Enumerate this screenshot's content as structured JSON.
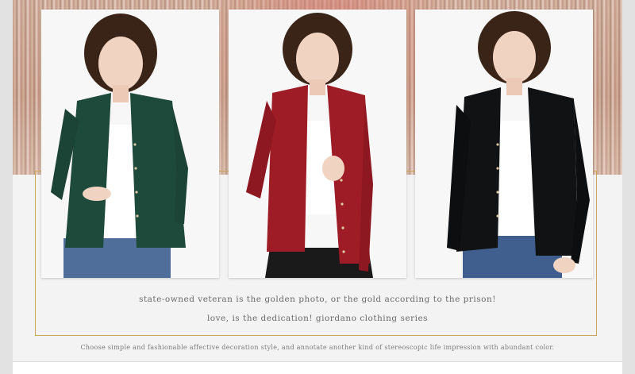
{
  "captions": {
    "line1": "state-owned veteran is the golden photo, or the gold according to the prison!",
    "line2": "love, is the dedication! giordano clothing series",
    "line3": "Choose simple and fashionable affective decoration style, and annotate another kind of stereoscopic life impression with abundant color."
  },
  "photos": [
    {
      "subject": "model-green-cardigan",
      "cardigan_color": "#1e4a3c"
    },
    {
      "subject": "model-red-cardigan",
      "cardigan_color": "#9e1c26"
    },
    {
      "subject": "model-black-cardigan",
      "cardigan_color": "#111214"
    }
  ],
  "colors": {
    "frame_gold": "#c9a65a",
    "caption_text": "#6a6a6a",
    "background": "#f3f3f3"
  }
}
